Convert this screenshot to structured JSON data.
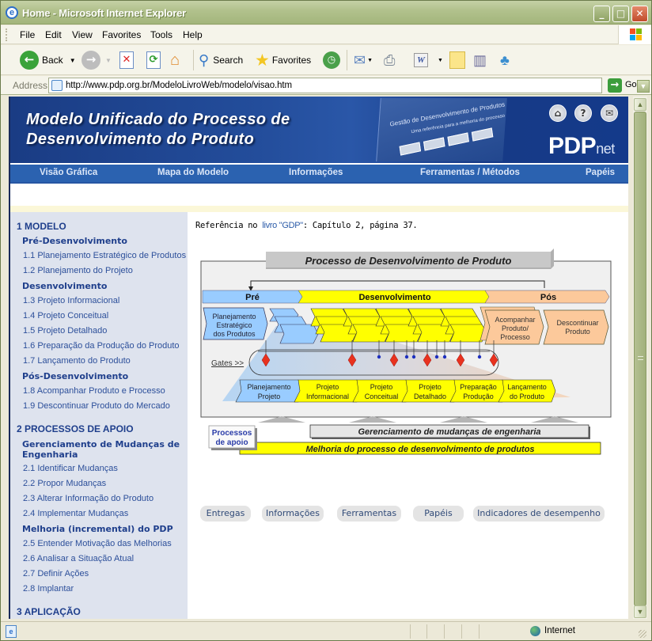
{
  "window": {
    "title": "Home - Microsoft Internet Explorer",
    "controls": {
      "minimize": "_",
      "maximize": "□",
      "close": "✕"
    }
  },
  "menu": [
    "File",
    "Edit",
    "View",
    "Favorites",
    "Tools",
    "Help"
  ],
  "toolbar": {
    "back_label": "Back",
    "search_label": "Search",
    "favorites_label": "Favorites"
  },
  "address": {
    "label": "Address",
    "url": "http://www.pdp.org.br/ModeloLivroWeb/modelo/visao.htm",
    "go_label": "Go"
  },
  "banner": {
    "title_line1": "Modelo Unificado do Processo de",
    "title_line2": "Desenvolvimento do Produto",
    "book_title": "Gestão de Desenvolvimento de Produtos",
    "book_subtitle": "Uma referência para a melhoria do processo",
    "logo_main": "PDP",
    "logo_sub": "net"
  },
  "nav": [
    "Visão Gráfica",
    "Mapa do Modelo",
    "Informações",
    "Ferramentas / Métodos",
    "Papéis"
  ],
  "sidebar": {
    "sections": [
      {
        "title": "1 MODELO",
        "groups": [
          {
            "title": "Pré-Desenvolvimento",
            "items": [
              "1.1 Planejamento Estratégico de Produtos",
              "1.2 Planejamento do Projeto"
            ]
          },
          {
            "title": "Desenvolvimento",
            "items": [
              "1.3 Projeto Informacional",
              "1.4 Projeto Conceitual",
              "1.5 Projeto Detalhado",
              "1.6 Preparação da Produção do Produto",
              "1.7 Lançamento do Produto"
            ]
          },
          {
            "title": "Pós-Desenvolvimento",
            "items": [
              "1.8 Acompanhar Produto e Processo",
              "1.9 Descontinuar Produto do Mercado"
            ]
          }
        ]
      },
      {
        "title": "2 PROCESSOS DE APOIO",
        "groups": [
          {
            "title": "Gerenciamento de Mudanças de Engenharia",
            "items": [
              "2.1 Identificar Mudanças",
              "2.2 Propor Mudanças",
              "2.3 Alterar Informação do Produto",
              "2.4 Implementar Mudanças"
            ]
          },
          {
            "title": "Melhoria (incremental) do PDP",
            "items": [
              "2.5 Entender Motivação das Melhorias",
              "2.6 Analisar a Situação Atual",
              "2.7 Definir Ações",
              "2.8 Implantar"
            ]
          }
        ]
      },
      {
        "title": "3 APLICAÇÃO",
        "groups": []
      }
    ]
  },
  "reference": {
    "prefix": "Referência no ",
    "link": "livro \"GDP\"",
    "suffix": ": Capítulo 2, página 37."
  },
  "diagram": {
    "title": "Processo de Desenvolvimento de Produto",
    "phases": [
      "Pré",
      "Desenvolvimento",
      "Pós"
    ],
    "pre_box": [
      "Planejamento",
      "Estratégico",
      "dos Produtos"
    ],
    "pos_boxes": [
      [
        "Acompanhar",
        "Produto/",
        "Processo"
      ],
      [
        "Descontinuar",
        "Produto"
      ]
    ],
    "gates_label": "Gates >>",
    "stages": [
      [
        "Planejamento",
        "Projeto"
      ],
      [
        "Projeto",
        "Informacional"
      ],
      [
        "Projeto",
        "Conceitual"
      ],
      [
        "Projeto",
        "Detalhado"
      ],
      [
        "Preparação",
        "Produção"
      ],
      [
        "Lançamento",
        "do Produto"
      ]
    ],
    "support_label": [
      "Processos",
      "de apoio"
    ],
    "support_1": "Gerenciamento de mudanças de engenharia",
    "support_2": "Melhoria do processo de desenvolvimento de produtos",
    "colors": {
      "pre": "#99ccff",
      "dev": "#ffff00",
      "pos": "#fcc99b",
      "gate": "#e8321e",
      "minor_gate": "#1d2fbf"
    }
  },
  "pills": [
    "Entregas",
    "Informações",
    "Ferramentas",
    "Papéis",
    "Indicadores de desempenho"
  ],
  "status": {
    "zone": "Internet"
  }
}
